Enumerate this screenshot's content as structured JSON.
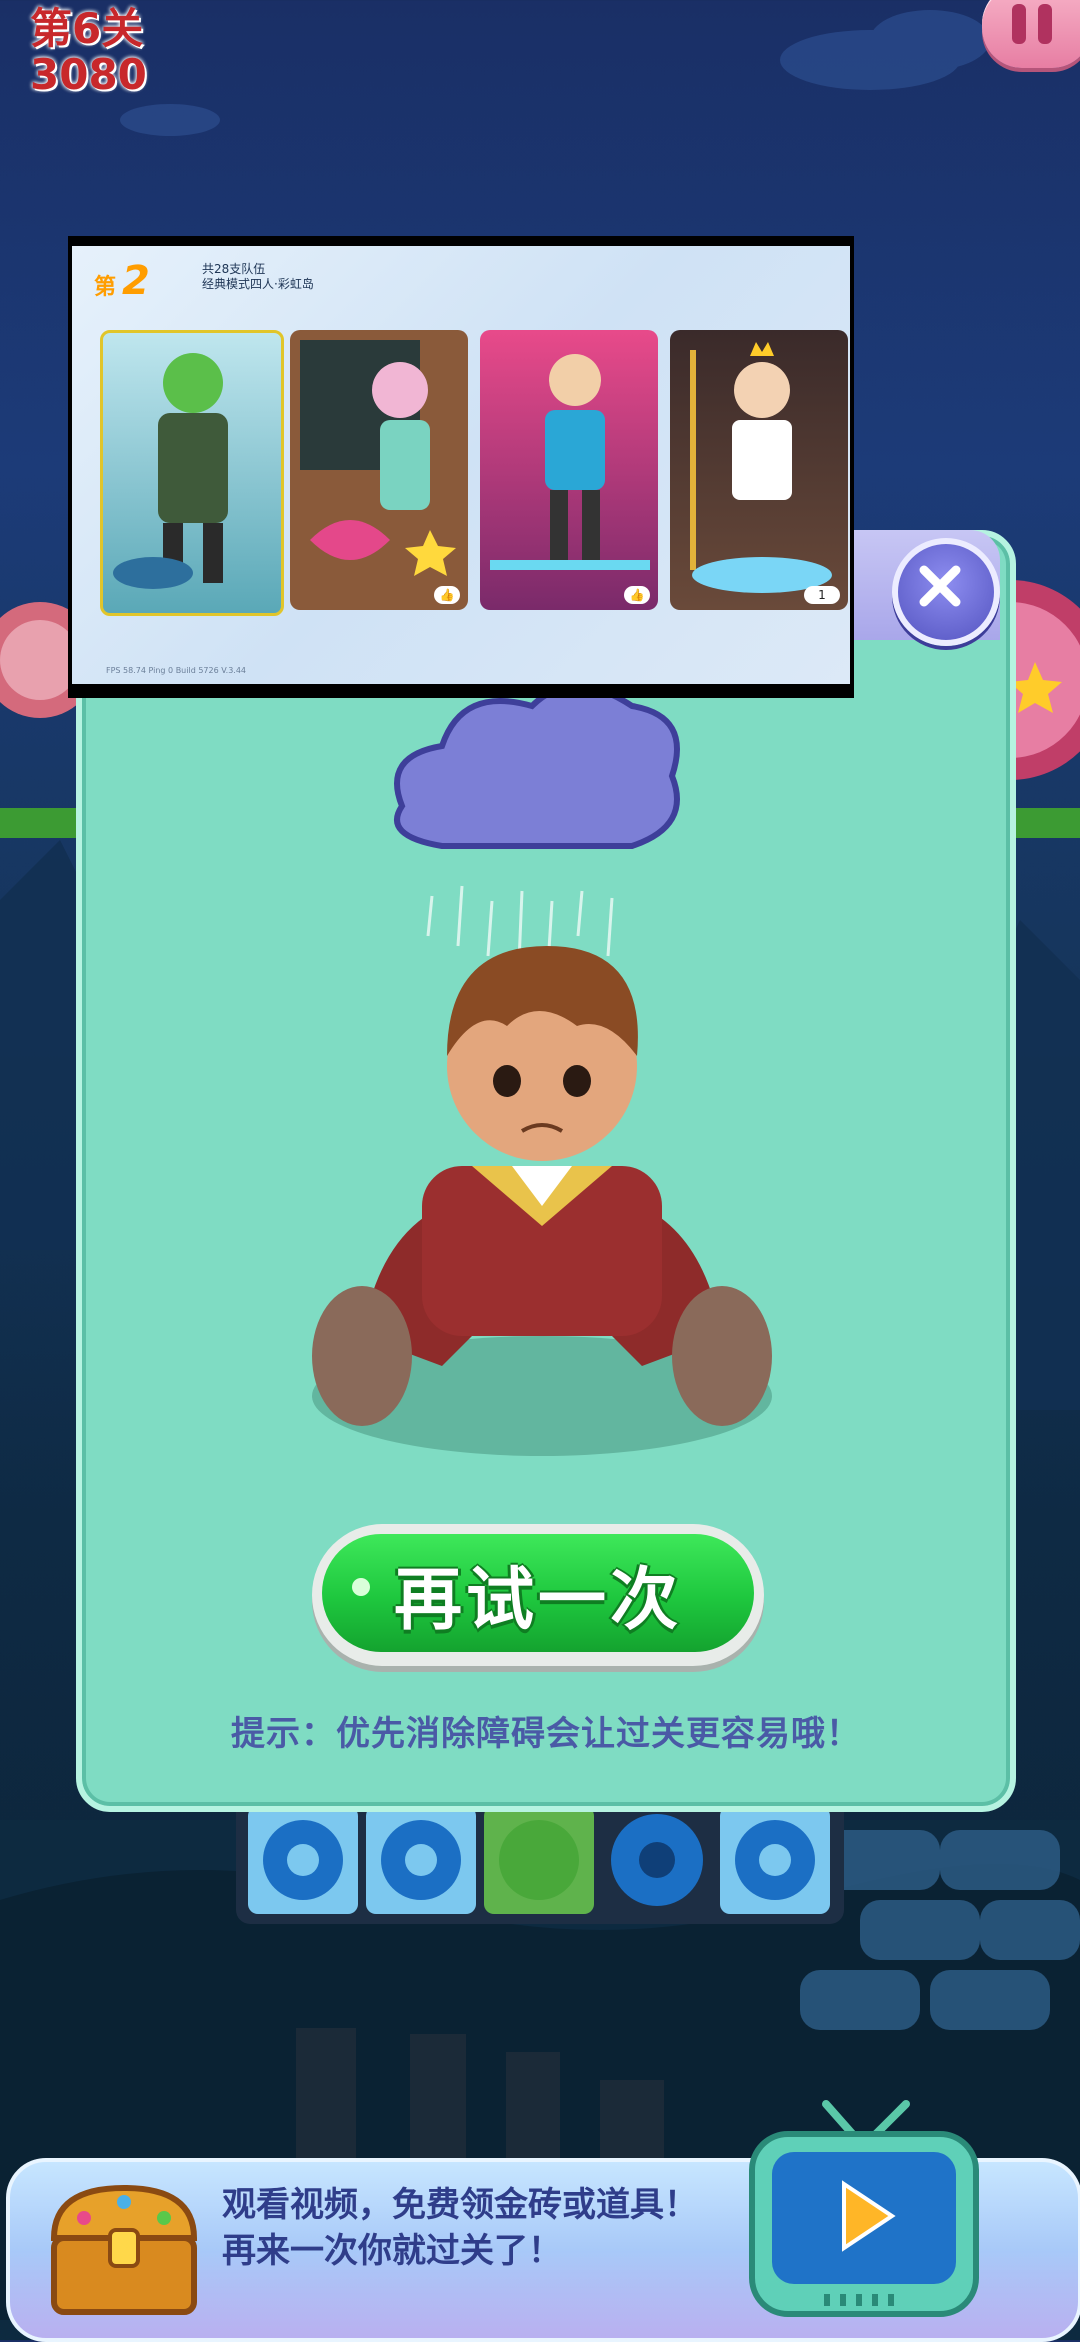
{
  "hud": {
    "level": "第6关",
    "score": "3080"
  },
  "ad": {
    "rank_prefix": "第",
    "rank_number": "2",
    "info_line1": "共28支队伍",
    "info_line2": "经典模式四人·彩虹岛",
    "card4_likes": "1",
    "footer": "FPS 58.74 Ping 0                    Build 5726 V.3.44"
  },
  "popup": {
    "retry_label": "再试一次",
    "hint": "提示：优先消除障碍会让过关更容易哦！"
  },
  "bottom": {
    "line1": "观看视频，免费领金砖或道具！",
    "line2": "再来一次你就过关了！"
  },
  "colors": {
    "popup_bg": "#7fdcc3",
    "retry_green": "#1ec73e",
    "level_red": "#c8282b",
    "hint_blue": "#4a5aa6"
  },
  "icons": [
    "pause-icon",
    "close-icon",
    "cloud-icon",
    "treasure-chest-icon",
    "tv-play-icon",
    "thumbs-up-icon"
  ]
}
